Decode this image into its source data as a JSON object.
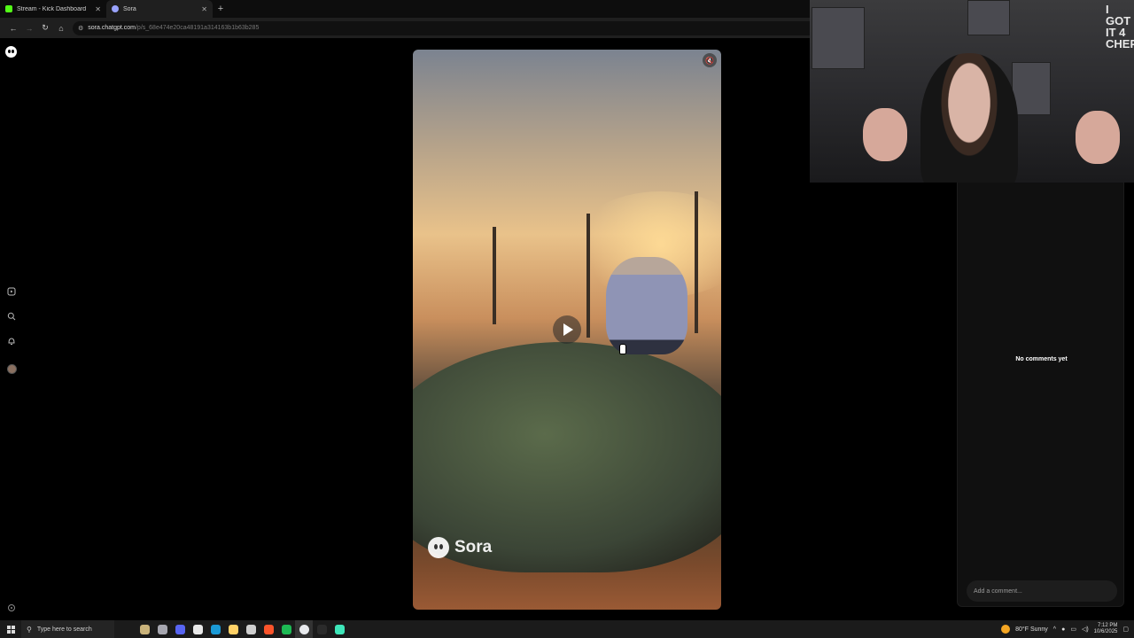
{
  "tabs": [
    {
      "title": "Stream - Kick Dashboard",
      "favicon_color": "#53fc18",
      "active": false
    },
    {
      "title": "Sora",
      "favicon_color": "#9aa3ff",
      "active": true
    }
  ],
  "address": {
    "host": "sora.chatgpt.com",
    "path": "/p/s_68e474e20ca48191a314163b1b63b285"
  },
  "video": {
    "watermark": "Sora",
    "mute_icon": "speaker-muted-icon",
    "play_icon": "play-icon"
  },
  "comments": {
    "empty_text": "No comments yet",
    "input_placeholder": "Add a comment..."
  },
  "webcam": {
    "wall_text": "I GOT IT 4 CHEP"
  },
  "taskbar": {
    "search_placeholder": "Type here to search",
    "weather": "80°F  Sunny",
    "time": "7:12 PM",
    "date": "10/6/2025",
    "app_icon_colors": [
      "#c9b27a",
      "#a7a7b0",
      "#5865f2",
      "#e8e8e8",
      "#1b9ad6",
      "#ffd166",
      "#cfcfcf",
      "#fb542b",
      "#1db954",
      "#e8eaed",
      "#2b2b2b",
      "#3ee6b9"
    ]
  }
}
